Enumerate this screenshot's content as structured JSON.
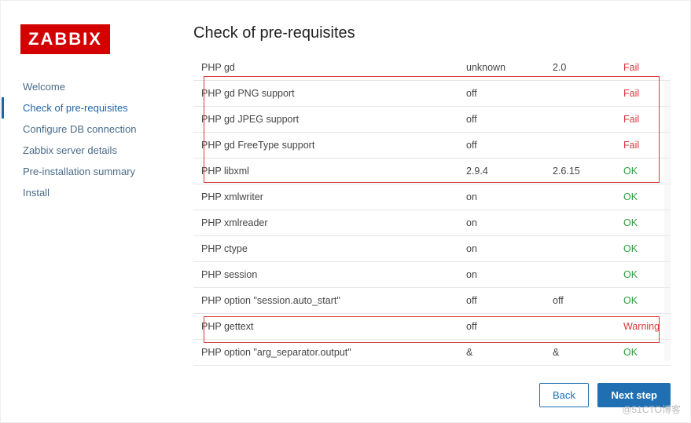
{
  "logo_text": "ZABBIX",
  "page_title": "Check of pre-requisites",
  "nav": {
    "items": [
      {
        "label": "Welcome"
      },
      {
        "label": "Check of pre-requisites"
      },
      {
        "label": "Configure DB connection"
      },
      {
        "label": "Zabbix server details"
      },
      {
        "label": "Pre-installation summary"
      },
      {
        "label": "Install"
      }
    ],
    "active_index": 1
  },
  "checks": [
    {
      "name": "PHP gd",
      "current": "unknown",
      "required": "2.0",
      "status": "Fail"
    },
    {
      "name": "PHP gd PNG support",
      "current": "off",
      "required": "",
      "status": "Fail"
    },
    {
      "name": "PHP gd JPEG support",
      "current": "off",
      "required": "",
      "status": "Fail"
    },
    {
      "name": "PHP gd FreeType support",
      "current": "off",
      "required": "",
      "status": "Fail"
    },
    {
      "name": "PHP libxml",
      "current": "2.9.4",
      "required": "2.6.15",
      "status": "OK"
    },
    {
      "name": "PHP xmlwriter",
      "current": "on",
      "required": "",
      "status": "OK"
    },
    {
      "name": "PHP xmlreader",
      "current": "on",
      "required": "",
      "status": "OK"
    },
    {
      "name": "PHP ctype",
      "current": "on",
      "required": "",
      "status": "OK"
    },
    {
      "name": "PHP session",
      "current": "on",
      "required": "",
      "status": "OK"
    },
    {
      "name": "PHP option \"session.auto_start\"",
      "current": "off",
      "required": "off",
      "status": "OK"
    },
    {
      "name": "PHP gettext",
      "current": "off",
      "required": "",
      "status": "Warning"
    },
    {
      "name": "PHP option \"arg_separator.output\"",
      "current": "&",
      "required": "&",
      "status": "OK"
    }
  ],
  "buttons": {
    "back": "Back",
    "next": "Next step"
  },
  "watermark": "@51CTO博客"
}
